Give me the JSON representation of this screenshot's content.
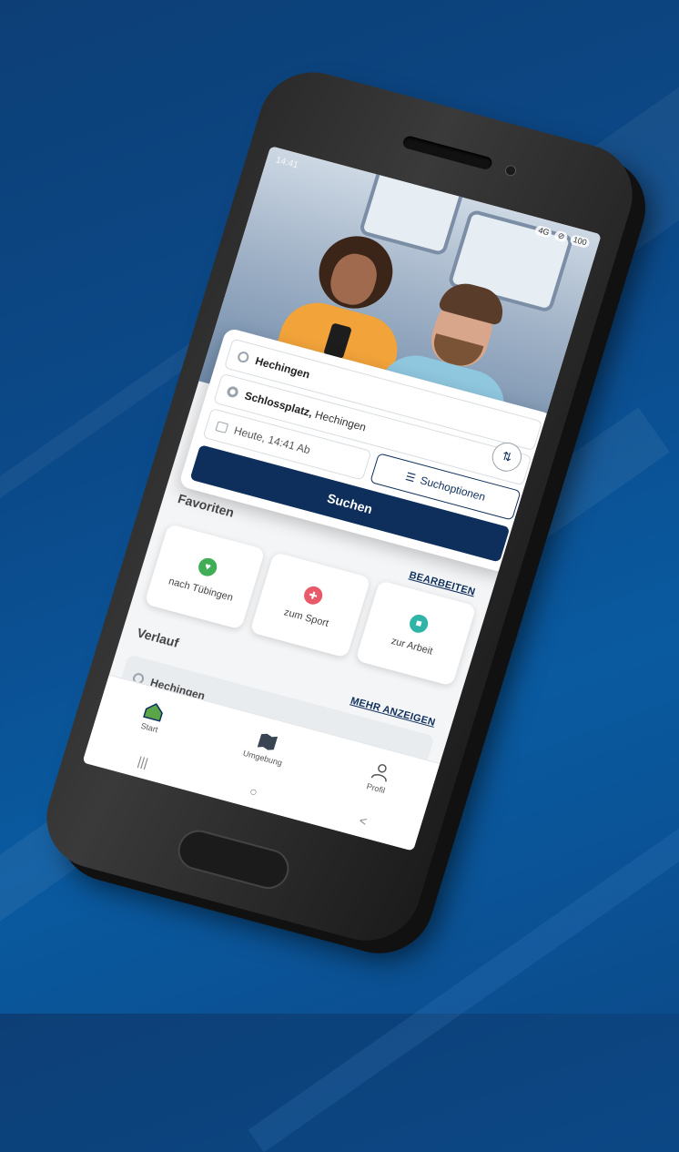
{
  "status": {
    "time": "14:41",
    "icons": [
      "4G",
      "⊘",
      "100"
    ]
  },
  "search": {
    "from": "Hechingen",
    "to_bold": "Schlossplatz,",
    "to_rest": " Hechingen",
    "when": "Heute, 14:41 Ab",
    "options_label": "Suchoptionen",
    "search_label": "Suchen",
    "swap_glyph": "⇅"
  },
  "favorites": {
    "title": "Favoriten",
    "edit_label": "BEARBEITEN",
    "items": [
      {
        "label": "nach Tübingen",
        "icon": "heart-icon",
        "color": "#3fae57",
        "glyph": "♥"
      },
      {
        "label": "zum Sport",
        "icon": "dumbbell-icon",
        "color": "#e8596a",
        "glyph": "✚"
      },
      {
        "label": "zur Arbeit",
        "icon": "building-icon",
        "color": "#2fb5a8",
        "glyph": "■"
      }
    ]
  },
  "history": {
    "title": "Verlauf",
    "more_label": "MEHR ANZEIGEN",
    "items": [
      {
        "label": "Hechingen"
      }
    ]
  },
  "tabbar": {
    "items": [
      {
        "label": "Start",
        "icon": "home-icon"
      },
      {
        "label": "Umgebung",
        "icon": "map-icon"
      },
      {
        "label": "Profil",
        "icon": "person-icon"
      }
    ]
  },
  "navbar": {
    "recent": "|||",
    "home": "○",
    "back": "<"
  },
  "colors": {
    "primary": "#0e2f5c",
    "background": "#0b4a8a"
  }
}
